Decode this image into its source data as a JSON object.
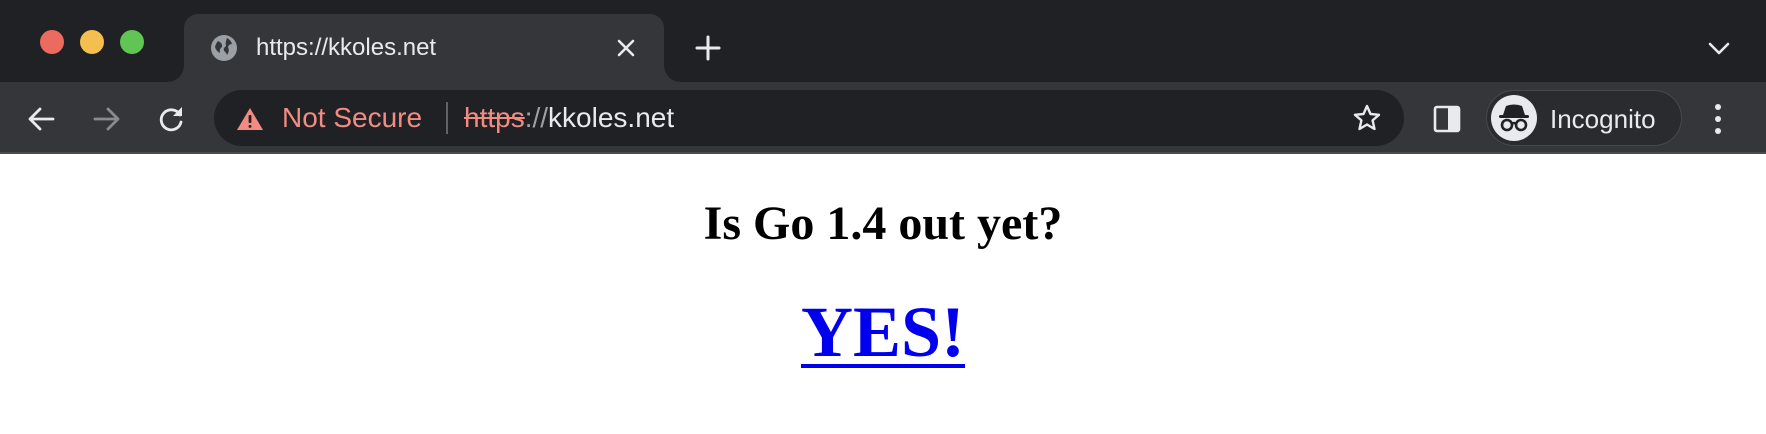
{
  "browser": {
    "tab": {
      "title": "https://kkoles.net",
      "favicon": "globe-icon"
    },
    "omnibox": {
      "security_label": "Not Secure",
      "url_scheme": "https",
      "url_separator": "://",
      "url_host": "kkoles.net"
    },
    "profile": {
      "label": "Incognito",
      "icon": "incognito-icon"
    },
    "colors": {
      "frame": "#202124",
      "toolbar": "#35363a",
      "warning": "#f28b82",
      "link": "#0000ee"
    }
  },
  "page": {
    "heading": "Is Go 1.4 out yet?",
    "answer": "YES!"
  }
}
